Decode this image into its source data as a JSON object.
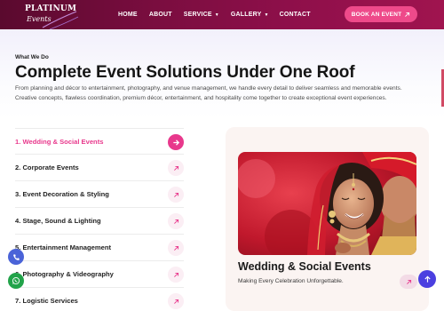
{
  "brand": {
    "logo_top": "PLATINUM",
    "logo_bottom": "Events"
  },
  "nav": {
    "items": [
      {
        "label": "HOME",
        "has_caret": false
      },
      {
        "label": "ABOUT",
        "has_caret": false
      },
      {
        "label": "SERVICE",
        "has_caret": true
      },
      {
        "label": "GALLERY",
        "has_caret": true
      },
      {
        "label": "CONTACT",
        "has_caret": false
      }
    ],
    "cta_label": "BOOK AN EVENT"
  },
  "hero": {
    "subheading": "What We Do",
    "title": "Complete Event Solutions Under One Roof",
    "description": "From planning and décor to entertainment, photography, and venue management, we handle every detail to deliver seamless and memorable events. Creative concepts, flawless coordination, premium décor, entertainment, and hospitality come together to create exceptional event experiences."
  },
  "services": [
    {
      "label": "1. Wedding & Social Events",
      "active": true
    },
    {
      "label": "2. Corporate Events",
      "active": false
    },
    {
      "label": "3. Event Decoration & Styling",
      "active": false
    },
    {
      "label": "4. Stage, Sound & Lighting",
      "active": false
    },
    {
      "label": "5. Entertainment Management",
      "active": false
    },
    {
      "label": "6. Photography & Videography",
      "active": false
    },
    {
      "label": "7. Logistic Services",
      "active": false
    }
  ],
  "card": {
    "title": "Wedding & Social Events",
    "subtitle": "Making Every Celebration Unforgettable."
  },
  "icons": {
    "arrow_up_right": "arrow-up-right-icon",
    "arrow_right": "arrow-right-icon",
    "phone": "phone-icon",
    "whatsapp": "whatsapp-icon",
    "scroll_top": "arrow-up-icon"
  },
  "colors": {
    "header_start": "#5a0a2e",
    "header_end": "#a0144f",
    "accent_pink": "#e8388c",
    "cta_pink": "#ee4a8a",
    "card_bg": "#fbf4f2",
    "phone_blue": "#4a63d8",
    "whatsapp_green": "#22a34a",
    "scroll_top_blue": "#4b3fe0"
  }
}
